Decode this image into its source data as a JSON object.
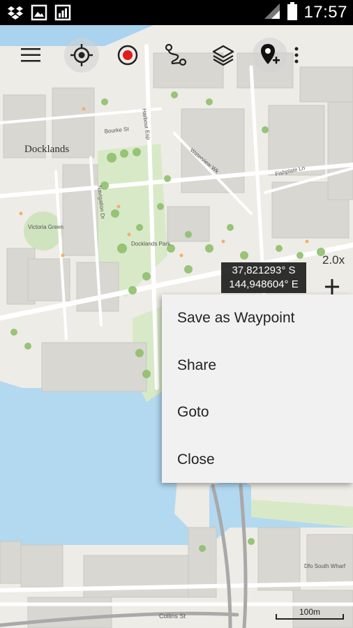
{
  "status_bar": {
    "time": "17:57",
    "left_icons": [
      "dropbox-icon",
      "gallery-icon",
      "chart-icon"
    ],
    "right_icons": [
      "signal-icon",
      "battery-icon"
    ]
  },
  "toolbar": {
    "buttons": [
      "menu-icon",
      "locate-icon",
      "record-icon",
      "route-icon",
      "layers-icon",
      "add-location-icon",
      "overflow-icon"
    ]
  },
  "map": {
    "labels": {
      "docklands": "Docklands",
      "victoria_green": "Victoria Green",
      "docklands_park": "Docklands Park",
      "south_wharf": "Dfo South Wharf",
      "bourke_st": "Bourke St",
      "harbour_esp": "Harbour Esp",
      "navigation_dr": "Navigation Dr",
      "waterview_wk": "Waterview Wk",
      "fishplate_ln": "Fishplate Ln",
      "collins_st": "Collins St"
    },
    "zoom_level": "2.0x",
    "scale_label": "100m"
  },
  "coordinate_popup": {
    "lat": "37,821293° S",
    "lon": "144,948604° E"
  },
  "context_menu": {
    "items": [
      "Save as Waypoint",
      "Share",
      "Goto",
      "Close"
    ]
  }
}
